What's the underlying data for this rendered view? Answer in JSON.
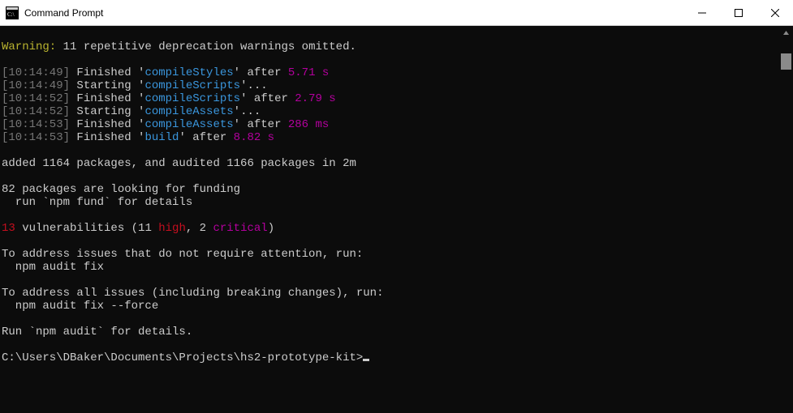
{
  "window": {
    "title": "Command Prompt"
  },
  "terminal": {
    "warning_label": "Warning:",
    "warning_text": " 11 repetitive deprecation warnings omitted.",
    "lines": [
      {
        "ts": "[10:14:49]",
        "verb": "Finished",
        "task": "compileStyles",
        "tail_word": "after",
        "dur": "5.71 s"
      },
      {
        "ts": "[10:14:49]",
        "verb": "Starting",
        "task": "compileScripts",
        "ellipsis": "..."
      },
      {
        "ts": "[10:14:52]",
        "verb": "Finished",
        "task": "compileScripts",
        "tail_word": "after",
        "dur": "2.79 s"
      },
      {
        "ts": "[10:14:52]",
        "verb": "Starting",
        "task": "compileAssets",
        "ellipsis": "..."
      },
      {
        "ts": "[10:14:53]",
        "verb": "Finished",
        "task": "compileAssets",
        "tail_word": "after",
        "dur": "286 ms"
      },
      {
        "ts": "[10:14:53]",
        "verb": "Finished",
        "task": "build",
        "tail_word": "after",
        "dur": "8.82 s"
      }
    ],
    "npm_added": "added 1164 packages, and audited 1166 packages in 2m",
    "funding_1": "82 packages are looking for funding",
    "funding_2": "  run `npm fund` for details",
    "vuln_count": "13",
    "vuln_mid": " vulnerabilities (11 ",
    "vuln_high": "high",
    "vuln_sep": ", 2 ",
    "vuln_crit": "critical",
    "vuln_end": ")",
    "address_1a": "To address issues that do not require attention, run:",
    "address_1b": "  npm audit fix",
    "address_2a": "To address all issues (including breaking changes), run:",
    "address_2b": "  npm audit fix --force",
    "audit_details": "Run `npm audit` for details.",
    "prompt": "C:\\Users\\DBaker\\Documents\\Projects\\hs2-prototype-kit>"
  }
}
